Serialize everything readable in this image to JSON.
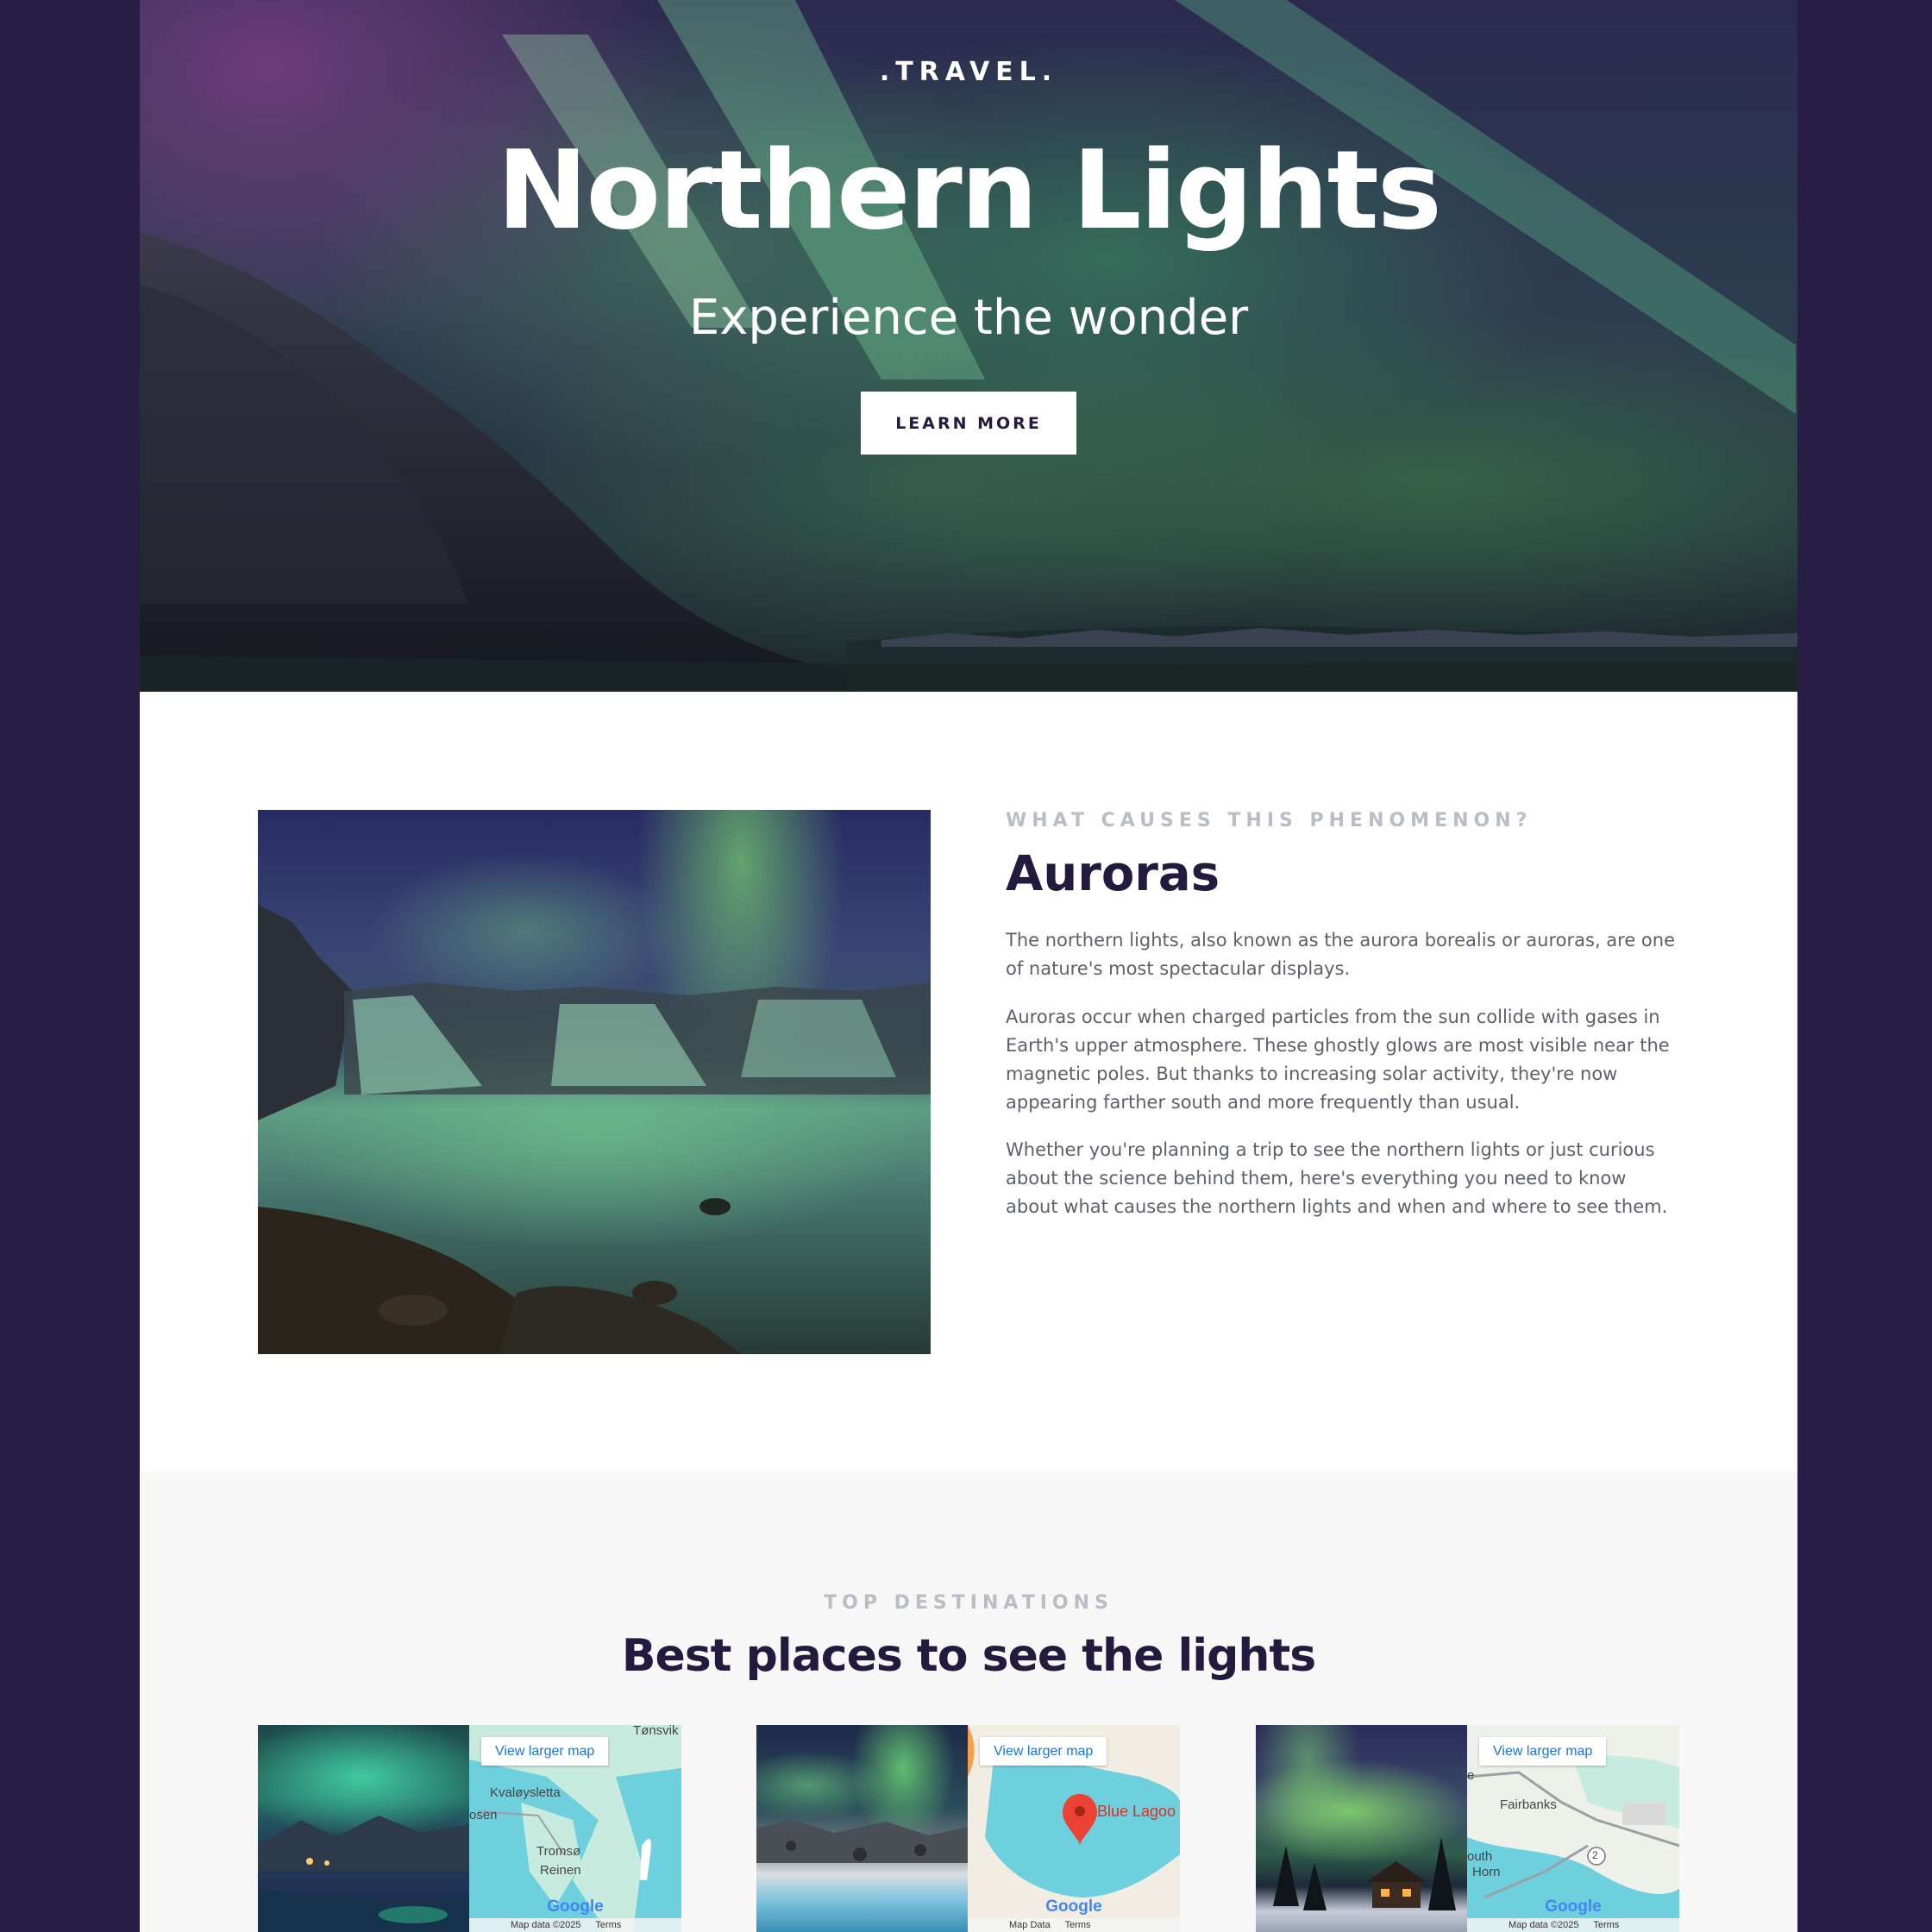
{
  "hero": {
    "brand": ".TRAVEL.",
    "title": "Northern Lights",
    "subtitle": "Experience the wonder",
    "button_label": "LEARN MORE"
  },
  "about": {
    "eyebrow": "WHAT CAUSES THIS PHENOMENON?",
    "title": "Auroras",
    "paragraphs": [
      "The northern lights, also known as the aurora borealis or auroras, are one of nature's most spectacular displays.",
      "Auroras occur when charged particles from the sun collide with gases in Earth's upper atmosphere. These ghostly glows are most visible near the magnetic poles. But thanks to increasing solar activity, they're now appearing farther south and more frequently than usual.",
      "Whether you're planning a trip to see the northern lights or just curious about the science behind them, here's everything you need to know about what causes the northern lights and when and where to see them."
    ]
  },
  "destinations": {
    "eyebrow": "TOP DESTINATIONS",
    "title": "Best places to see the lights",
    "cards": [
      {
        "map_button": "View larger map",
        "labels": [
          "Tønsvik",
          "Kvaløysletta",
          "osen",
          "Tromsø",
          "Reinen"
        ],
        "google": "Google",
        "footer": [
          "Map data ©2025",
          "Terms"
        ]
      },
      {
        "map_button": "View larger map",
        "labels": [
          "Blue Lagoo"
        ],
        "google": "Google",
        "footer": [
          "Map Data",
          "Terms"
        ]
      },
      {
        "map_button": "View larger map",
        "labels": [
          "e",
          "Fairbanks",
          "outh",
          "Horn",
          "2"
        ],
        "google": "Google",
        "footer": [
          "Map data ©2025",
          "Terms"
        ]
      }
    ]
  },
  "colors": {
    "background": "#271d45",
    "heading": "#231a3d",
    "body_text": "#5f5f6b",
    "eyebrow": "#bcbcc6",
    "map_link": "#1a73e8"
  }
}
